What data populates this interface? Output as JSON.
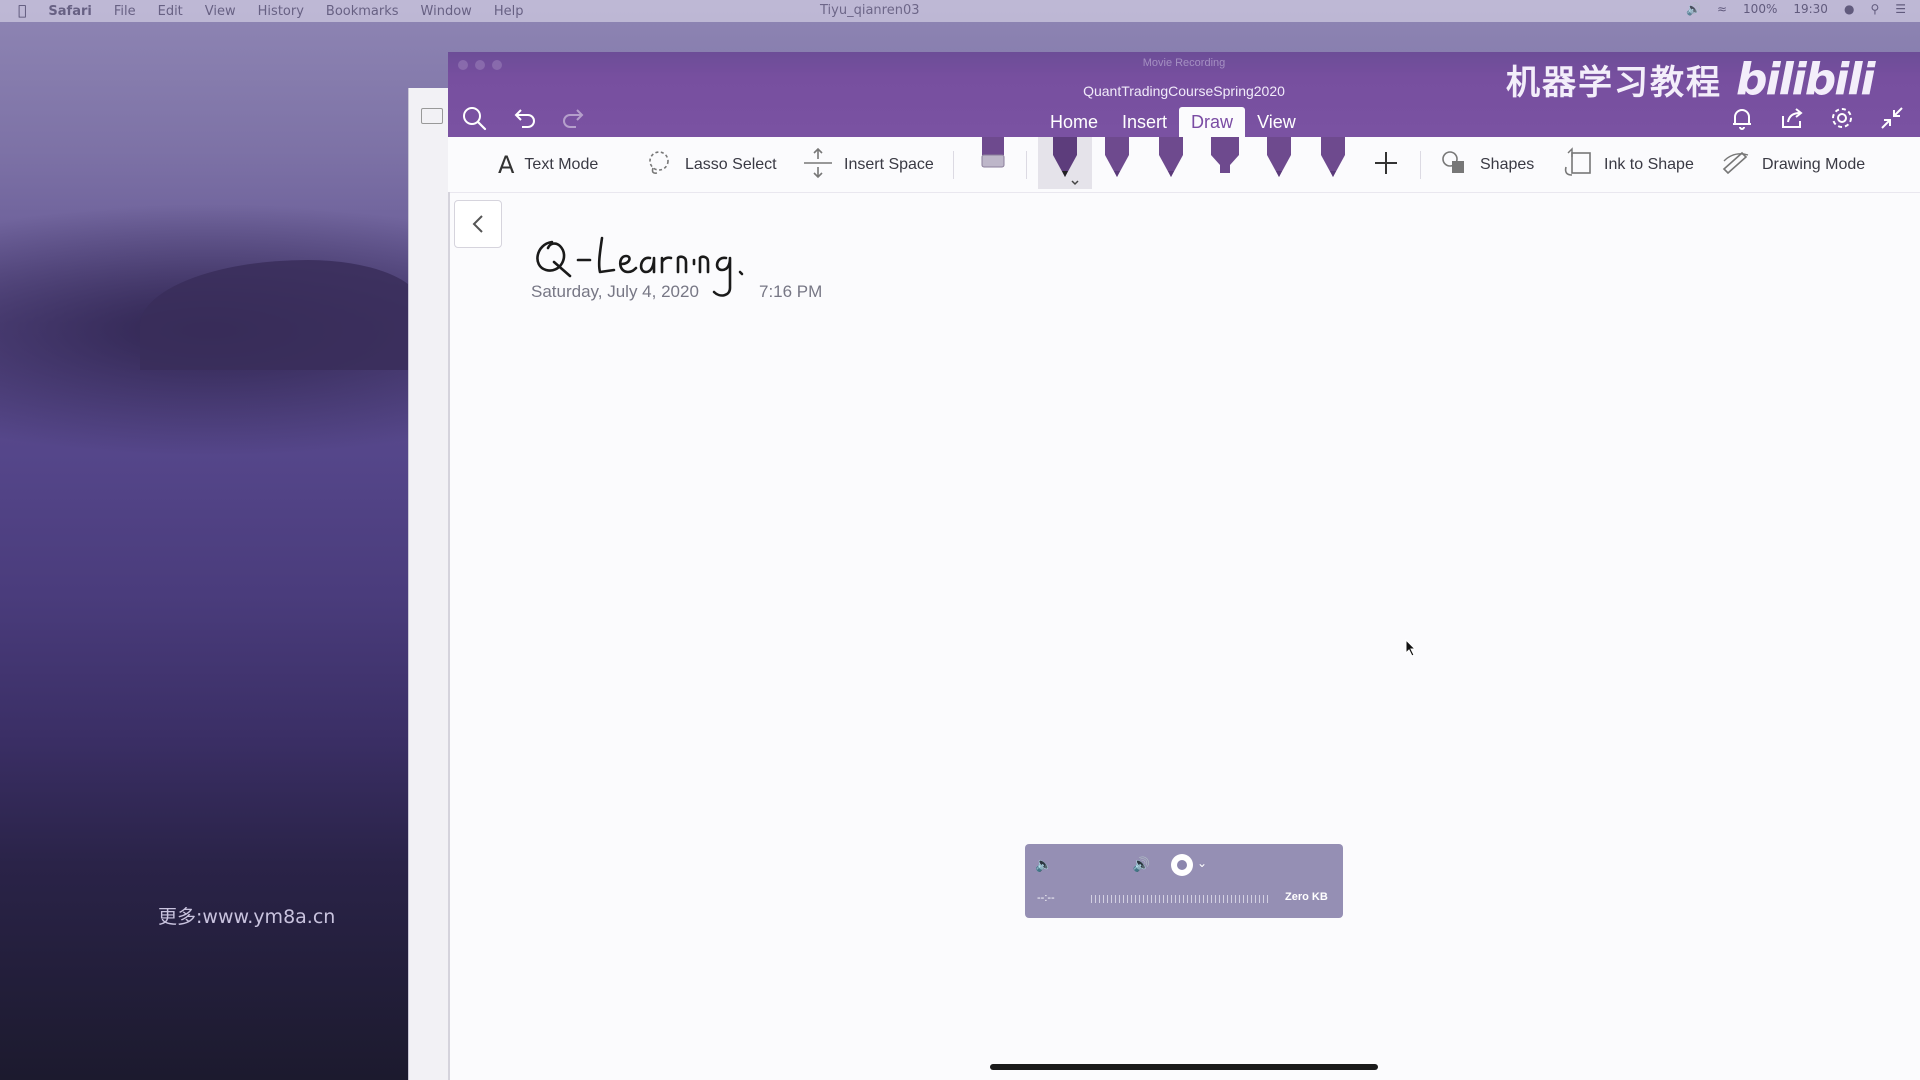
{
  "menubar": {
    "app_name": "Safari",
    "items": [
      "File",
      "Edit",
      "View",
      "History",
      "Bookmarks",
      "Window",
      "Help"
    ],
    "center_title": "Tiyu_qianren03",
    "battery": "100%",
    "clock": "19:30"
  },
  "window": {
    "recording_title": "Movie Recording",
    "document_title": "QuantTradingCourseSpring2020"
  },
  "tabs": [
    "Home",
    "Insert",
    "Draw",
    "View"
  ],
  "active_tab": "Draw",
  "ribbon": {
    "text_mode": "Text Mode",
    "lasso_select": "Lasso Select",
    "insert_space": "Insert Space",
    "shapes": "Shapes",
    "ink_to_shape": "Ink to Shape",
    "drawing_mode": "Drawing Mode"
  },
  "page": {
    "title_handwritten": "Q-Learning.",
    "date": "Saturday, July 4, 2020",
    "time": "7:16 PM"
  },
  "recorder": {
    "elapsed": "--:--",
    "size": "Zero KB"
  },
  "overlay": {
    "bili_cn": "机器学习教程",
    "bili_logo": "bilibili",
    "url_watermark": "更多:www.ym8a.cn"
  },
  "colors": {
    "titlebar": "#7a52a2",
    "accent": "#7a4ca3",
    "pen": "#6e4a8e"
  }
}
